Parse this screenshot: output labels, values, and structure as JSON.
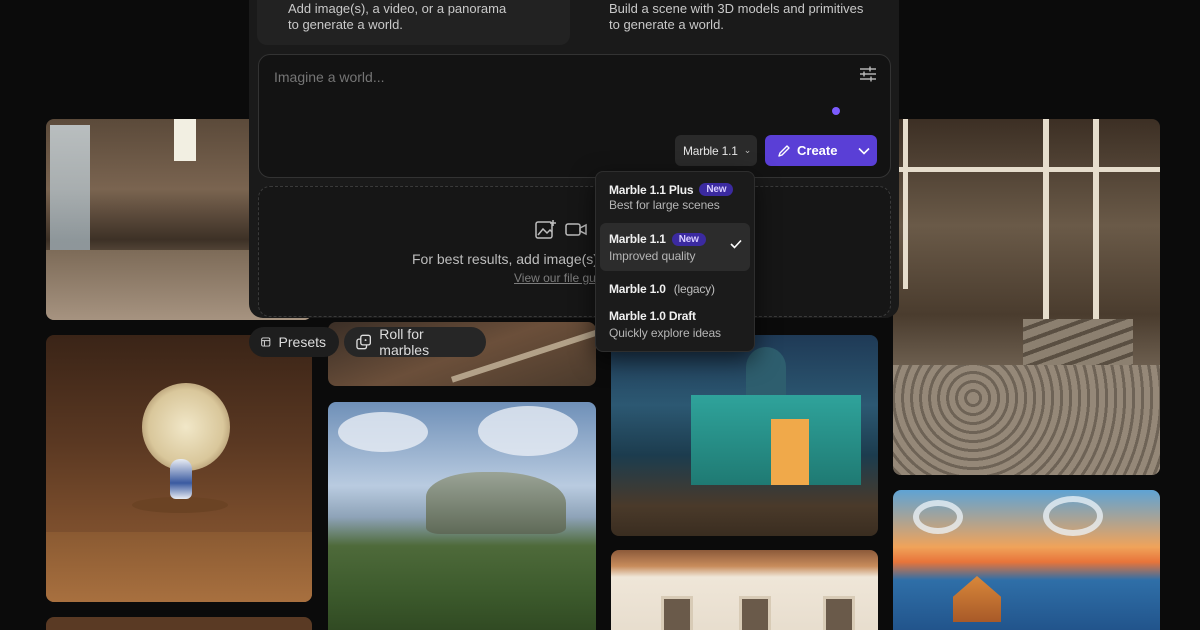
{
  "mode_cards": {
    "left_text": "Add image(s), a video, or a panorama to generate a world.",
    "right_text": "Build a scene with 3D models and primitives to generate a world."
  },
  "prompt": {
    "placeholder": "Imagine a world...",
    "settings_icon": "sliders-icon"
  },
  "toolbar": {
    "model_label": "Marble 1.1",
    "create_label": "Create"
  },
  "drop_zone": {
    "text": "For best results, add image(s), a video, or a panorama",
    "link": "View our file guide"
  },
  "chips": {
    "presets_label": "Presets",
    "roll_label": "Roll for marbles"
  },
  "model_menu": {
    "options": [
      {
        "title": "Marble 1.1 Plus",
        "badge": "New",
        "subtitle": "Best for large scenes",
        "selected": false
      },
      {
        "title": "Marble 1.1",
        "badge": "New",
        "subtitle": "Improved quality",
        "selected": true
      },
      {
        "title": "Marble 1.0",
        "tag": "(legacy)",
        "selected": false
      },
      {
        "title": "Marble 1.0 Draft",
        "subtitle": "Quickly explore ideas",
        "selected": false
      }
    ]
  },
  "colors": {
    "accent": "#5a3fd6",
    "badge_bg": "#3b2aa0",
    "panel_bg": "#1a1a1a",
    "page_bg": "#0b0b0b"
  }
}
